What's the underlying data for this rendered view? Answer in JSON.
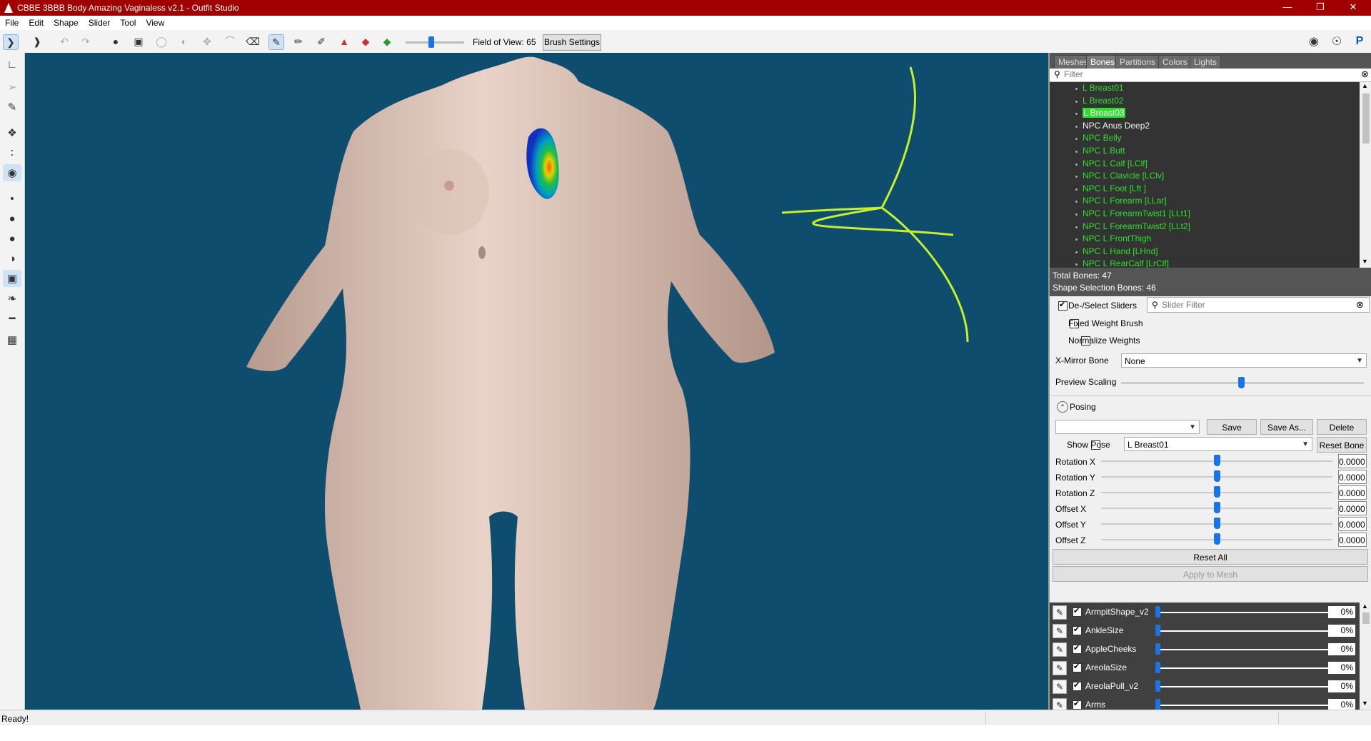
{
  "window": {
    "title": "CBBE 3BBB Body Amazing Vaginaless v2.1 - Outfit Studio"
  },
  "menu": [
    "File",
    "Edit",
    "Shape",
    "Slider",
    "Tool",
    "View"
  ],
  "toolbar": {
    "fov_label": "Field of View: 65",
    "brush_settings": "Brush Settings"
  },
  "tabs": [
    "Meshes",
    "Bones",
    "Partitions",
    "Colors",
    "Lights"
  ],
  "bones": {
    "filter_placeholder": "Filter",
    "items": [
      {
        "label": "L Breast01"
      },
      {
        "label": "L Breast02"
      },
      {
        "label": "L Breast03"
      },
      {
        "label": "NPC Anus Deep2"
      },
      {
        "label": "NPC Belly"
      },
      {
        "label": "NPC L Butt"
      },
      {
        "label": "NPC L Calf [LClf]"
      },
      {
        "label": "NPC L Clavicle [LClv]"
      },
      {
        "label": "NPC L Foot [Lft ]"
      },
      {
        "label": "NPC L Forearm [LLar]"
      },
      {
        "label": "NPC L ForearmTwist1 [LLt1]"
      },
      {
        "label": "NPC L ForearmTwist2 [LLt2]"
      },
      {
        "label": "NPC L FrontThigh"
      },
      {
        "label": "NPC L Hand [LHnd]"
      },
      {
        "label": "NPC L RearCalf [LrClf]"
      }
    ],
    "total": "Total Bones: 47",
    "selection": "Shape Selection Bones: 46"
  },
  "options": {
    "deselect_sliders": "De-/Select Sliders",
    "slider_filter_placeholder": "Slider Filter",
    "fixed_weight": "Fixed Weight Brush",
    "normalize": "Normalize Weights",
    "xmirror_label": "X-Mirror Bone",
    "xmirror_value": "None",
    "preview_scaling": "Preview Scaling"
  },
  "posing": {
    "header": "Posing",
    "save": "Save",
    "save_as": "Save As...",
    "delete": "Delete",
    "show_pose": "Show Pose",
    "bone_value": "L Breast01",
    "reset_bone": "Reset Bone",
    "rows": [
      {
        "label": "Rotation X",
        "value": "0.0000"
      },
      {
        "label": "Rotation Y",
        "value": "0.0000"
      },
      {
        "label": "Rotation Z",
        "value": "0.0000"
      },
      {
        "label": "Offset X",
        "value": "0.0000"
      },
      {
        "label": "Offset Y",
        "value": "0.0000"
      },
      {
        "label": "Offset Z",
        "value": "0.0000"
      }
    ],
    "reset_all": "Reset All",
    "apply": "Apply to Mesh"
  },
  "sliders": [
    {
      "name": "ArmpitShape_v2",
      "value": "0%",
      "level": 0.0
    },
    {
      "name": "AnkleSize",
      "value": "0%",
      "level": 0.0
    },
    {
      "name": "AppleCheeks",
      "value": "0%",
      "level": 0.0
    },
    {
      "name": "AreolaSize",
      "value": "0%",
      "level": 0.0
    },
    {
      "name": "AreolaPull_v2",
      "value": "0%",
      "level": 0.0
    },
    {
      "name": "Arms",
      "value": "0%",
      "level": 0.0
    }
  ],
  "status": "Ready!",
  "colors": {
    "viewport": "#0e4d6e",
    "bone_text": "#2ee02e",
    "titlebar": "#a00000",
    "annotation": "#c6f02a"
  }
}
